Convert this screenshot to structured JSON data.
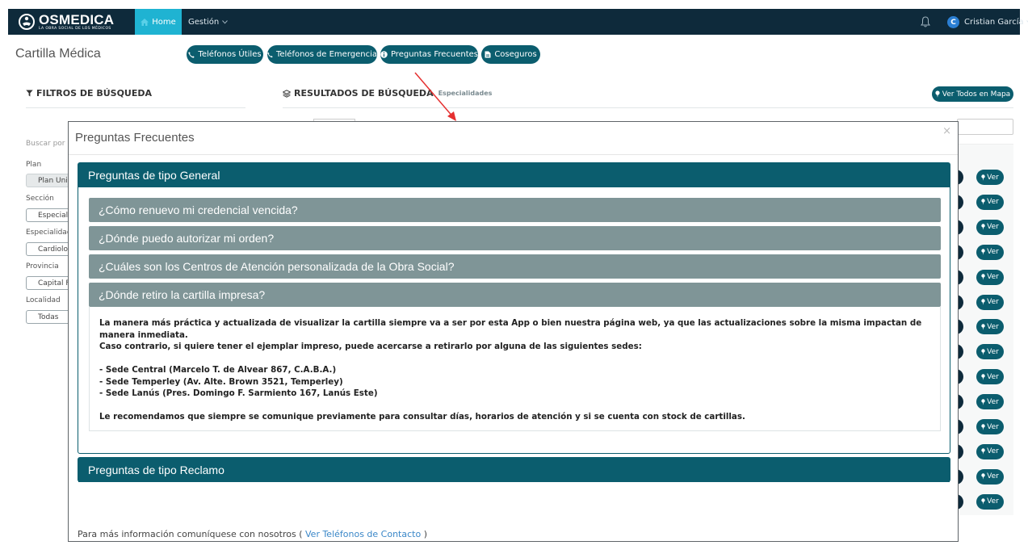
{
  "colors": {
    "navbar": "#0e2a3b",
    "accent": "#0b5d6e",
    "home_active": "#1fb3d2",
    "question_bg": "#7f9597",
    "annotation_arrow": "#e53030"
  },
  "navbar": {
    "logo_name": "OSMEDICA",
    "logo_sub": "LA OBRA SOCIAL DE LOS MÉDICOS",
    "home_label": "Home",
    "gestion_label": "Gestión",
    "user_initial": "C",
    "user_name": "Cristian García"
  },
  "page": {
    "title": "Cartilla Médica",
    "pills": [
      {
        "label": "Teléfonos Útiles",
        "icon": "phone-icon"
      },
      {
        "label": "Teléfonos de Emergencia",
        "icon": "phone-icon"
      },
      {
        "label": "Preguntas Frecuentes",
        "icon": "info-icon"
      },
      {
        "label": "Coseguros",
        "icon": "file-icon"
      }
    ]
  },
  "filters": {
    "heading": "FILTROS DE BÚSQUEDA",
    "search_placeholder": "Buscar por",
    "fields": [
      {
        "label": "Plan",
        "value": "Plan Univ"
      },
      {
        "label": "Sección",
        "value": "Especiali"
      },
      {
        "label": "Especialidad",
        "value": "Cardiolog"
      },
      {
        "label": "Provincia",
        "value": "Capital F"
      },
      {
        "label": "Localidad",
        "value": "Todas"
      }
    ]
  },
  "results": {
    "heading": "RESULTADOS DE BÚSQUEDA",
    "subheading": "Especialidades",
    "map_button": "Ver Todos en Mapa",
    "ver_label": "Ver",
    "ver_count": 14
  },
  "modal": {
    "title": "Preguntas Frecuentes",
    "close": "×",
    "group_general": "Preguntas de tipo General",
    "questions": [
      "¿Cómo renuevo mi credencial vencida?",
      "¿Dónde puedo autorizar mi orden?",
      "¿Cuáles son los Centros de Atención personalizada de la Obra Social?",
      "¿Dónde retiro la cartilla impresa?"
    ],
    "answer": {
      "line1": "La manera más práctica y actualizada de visualizar la cartilla siempre va a ser por esta App o bien nuestra página web, ya que las actualizaciones sobre la misma impactan de manera inmediata.",
      "line2": "Caso contrario, si quiere tener el ejemplar impreso, puede acercarse a retirarlo por alguna de las siguientes sedes:",
      "sede1": "- Sede Central (Marcelo T. de Alvear 867, C.A.B.A.)",
      "sede2": "- Sede Temperley (Av. Alte. Brown 3521, Temperley)",
      "sede3": "- Sede Lanús (Pres. Domingo F. Sarmiento 167, Lanús Este)",
      "closing": "Le recomendamos que siempre se comunique previamente para consultar días, horarios de atención y si se cuenta con stock de cartillas."
    },
    "group_reclamo": "Preguntas de tipo Reclamo",
    "footer_text": "Para más información comuníquese con nosotros ( ",
    "footer_link": "Ver Teléfonos de Contacto",
    "footer_end": " )"
  }
}
